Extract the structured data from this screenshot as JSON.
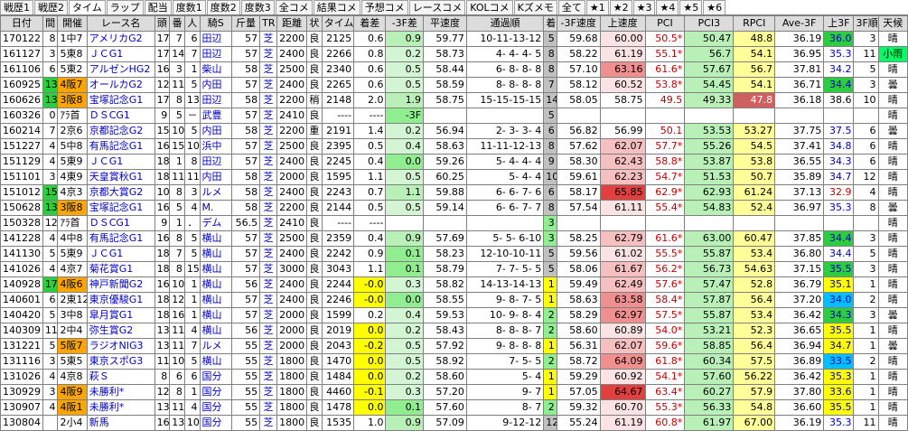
{
  "tabs": [
    "戦歴1",
    "戦歴2",
    "タイム",
    "ラップ",
    "配当",
    "度数1",
    "度数2",
    "度数3",
    "全コメ",
    "結果コメ",
    "予想コメ",
    "レースコメ",
    "KOLコメ",
    "Kズメモ",
    "全て",
    "★1",
    "★2",
    "★3",
    "★4",
    "★5",
    "★6"
  ],
  "active_tab": 2,
  "columns": [
    "日付",
    "間",
    "開催",
    "レース名",
    "頭",
    "番",
    "人",
    "騎S",
    "斤量",
    "TR",
    "距離",
    "状",
    "タイム",
    "着差",
    "-3F差",
    "平速度",
    "通過順",
    "着",
    "-3F速度",
    "上速度",
    "PCI",
    "PCI3",
    "RPCI",
    "Ave-3F",
    "上3F",
    "3F順",
    "天候"
  ],
  "rows": [
    {
      "d": "170122",
      "k": "8",
      "kai": "1中7",
      "race": "アメリカG2",
      "h": "17",
      "b": "7",
      "n": "6",
      "j": "田辺",
      "w": "57",
      "tr": "芝",
      "dist": "2200",
      "st": "良",
      "time": "2125",
      "diff": "0.6",
      "f3": "0.9",
      "hs": "59.77",
      "pass": "10-11-13-12",
      "ch": "5",
      "f3s": "59.68",
      "us": "60.00",
      "pci": "50.5*",
      "pci3": "50.47",
      "rpci": "48.8",
      "ave": "36.19",
      "up": "36.0",
      "up_rank": "3",
      "wx": "晴"
    },
    {
      "d": "161127",
      "k": "3",
      "kai": "5東8",
      "race": "ＪＣG1",
      "h": "17",
      "b": "14",
      "n": "7",
      "j": "田辺",
      "w": "57",
      "tr": "芝",
      "dist": "2400",
      "st": "良",
      "time": "2266",
      "diff": "0.8",
      "f3": "0.2",
      "hs": "58.73",
      "pass": "4- 4- 4- 5",
      "ch": "8",
      "f3s": "58.22",
      "us": "61.19",
      "pci": "55.1*",
      "pci3": "56.7",
      "rpci": "54.1",
      "ave": "36.95",
      "up": "35.3",
      "up_rank": "11",
      "wx": "小雨"
    },
    {
      "d": "161106",
      "k": "6",
      "kai": "5東2",
      "race": "アルゼンHG2",
      "h": "16",
      "b": "3",
      "n": "1",
      "j": "柴山",
      "w": "58",
      "tr": "芝",
      "dist": "2500",
      "st": "良",
      "time": "2340",
      "diff": "0.6",
      "f3": "0.5",
      "hs": "58.44",
      "pass": "6- 8- 8- 8",
      "ch": "8",
      "f3s": "57.10",
      "us": "63.16",
      "pci": "61.6*",
      "pci3": "57.67",
      "rpci": "56.7",
      "ave": "37.81",
      "up": "34.2",
      "up_rank": "5",
      "wx": "晴"
    },
    {
      "d": "160925",
      "k": "13",
      "kai": "4阪7",
      "race": "オールカG2",
      "h": "12",
      "b": "11",
      "n": "5",
      "j": "内田",
      "w": "57",
      "tr": "芝",
      "dist": "2400",
      "st": "良",
      "time": "2265",
      "diff": "0.6",
      "f3": "0.5",
      "hs": "58.59",
      "pass": "8- 8- 8- 8",
      "ch": "7",
      "f3s": "58.12",
      "us": "60.52",
      "pci": "53.8*",
      "pci3": "54.45",
      "rpci": "54.1",
      "ave": "36.71",
      "up": "34.4",
      "up_rank": "3",
      "wx": "曇"
    },
    {
      "d": "160626",
      "k": "13",
      "kai": "3阪8",
      "race": "宝塚記念G1",
      "h": "17",
      "b": "8",
      "n": "13",
      "j": "田辺",
      "w": "58",
      "tr": "芝",
      "dist": "2200",
      "st": "稍",
      "time": "2148",
      "diff": "2.0",
      "f3": "1.9",
      "hs": "58.75",
      "pass": "15-15-15-15",
      "ch": "14",
      "f3s": "58.05",
      "us": "58.75",
      "pci": "49.5",
      "pci3": "49.33",
      "rpci": "47.8",
      "ave": "36.18",
      "up": "38.6",
      "up_rank": "10",
      "wx": "晴"
    },
    {
      "d": "160326",
      "k": "0",
      "kai": "ｱﾗ首",
      "race": "ＤＳCG1",
      "h": "9",
      "b": "5",
      "n": "－",
      "j": "武豊",
      "w": "57",
      "tr": "芝",
      "dist": "2410",
      "st": "良",
      "time": "----",
      "diff": "----",
      "f3": "-3F",
      "hs": "",
      "pass": "",
      "ch": "5",
      "f3s": "",
      "us": "",
      "pci": "",
      "pci3": "",
      "rpci": "",
      "ave": "",
      "up": "",
      "up_rank": "",
      "wx": "晴"
    },
    {
      "d": "160214",
      "k": "7",
      "kai": "2京6",
      "race": "京都記念G2",
      "h": "15",
      "b": "10",
      "n": "5",
      "j": "内田",
      "w": "58",
      "tr": "芝",
      "dist": "2200",
      "st": "重",
      "time": "2191",
      "diff": "1.4",
      "f3": "0.2",
      "hs": "56.94",
      "pass": "2- 3- 3- 4",
      "ch": "6",
      "f3s": "56.82",
      "us": "56.99",
      "pci": "50.1",
      "pci3": "53.53",
      "rpci": "53.27",
      "ave": "37.75",
      "up": "37.5",
      "up_rank": "6",
      "wx": "曇"
    },
    {
      "d": "151227",
      "k": "4",
      "kai": "5中8",
      "race": "有馬記念G1",
      "h": "16",
      "b": "15",
      "n": "10",
      "j": "浜中",
      "w": "57",
      "tr": "芝",
      "dist": "2500",
      "st": "良",
      "time": "2395",
      "diff": "0.5",
      "f3": "0.4",
      "hs": "58.63",
      "pass": "11-11-12-13",
      "ch": "8",
      "f3s": "57.62",
      "us": "62.07",
      "pci": "57.7*",
      "pci3": "55.26",
      "rpci": "54.5",
      "ave": "37.41",
      "up": "34.8",
      "up_rank": "6",
      "wx": "晴"
    },
    {
      "d": "151129",
      "k": "4",
      "kai": "5東9",
      "race": "ＪＣG1",
      "h": "18",
      "b": "1",
      "n": "8",
      "j": "田辺",
      "w": "57",
      "tr": "芝",
      "dist": "2400",
      "st": "良",
      "time": "2245",
      "diff": "0.4",
      "f3": "0.0",
      "hs": "59.26",
      "pass": "5- 4- 4- 4",
      "ch": "9",
      "f3s": "58.30",
      "us": "62.43",
      "pci": "58.8*",
      "pci3": "53.87",
      "rpci": "53.8",
      "ave": "36.55",
      "up": "34.3",
      "up_rank": "6",
      "wx": "晴"
    },
    {
      "d": "151101",
      "k": "3",
      "kai": "4東9",
      "race": "天皇賞秋G1",
      "h": "18",
      "b": "11",
      "n": "11",
      "j": "内田",
      "w": "58",
      "tr": "芝",
      "dist": "2000",
      "st": "良",
      "time": "1595",
      "diff": "1.1",
      "f3": "0.5",
      "hs": "60.25",
      "pass": "5- 4- 4",
      "ch": "10",
      "f3s": "59.61",
      "us": "62.23",
      "pci": "54.7*",
      "pci3": "51.53",
      "rpci": "50.7",
      "ave": "35.89",
      "up": "34.7",
      "up_rank": "12",
      "wx": "晴"
    },
    {
      "d": "151012",
      "k": "15",
      "kai": "4京3",
      "race": "京都大賞G2",
      "h": "10",
      "b": "8",
      "n": "3",
      "j": "ルメ",
      "w": "58",
      "tr": "芝",
      "dist": "2400",
      "st": "良",
      "time": "2243",
      "diff": "0.7",
      "f3": "1.1",
      "hs": "59.88",
      "pass": "6- 6- 7- 6",
      "ch": "6",
      "f3s": "58.17",
      "us": "65.85",
      "pci": "62.9*",
      "pci3": "62.93",
      "rpci": "61.24",
      "ave": "37.13",
      "up": "32.9",
      "up_rank": "4",
      "wx": "晴"
    },
    {
      "d": "150628",
      "k": "13",
      "kai": "3阪8",
      "race": "宝塚記念G1",
      "h": "16",
      "b": "5",
      "n": "4",
      "j": "M.",
      "w": "58",
      "tr": "芝",
      "dist": "2200",
      "st": "良",
      "time": "2144",
      "diff": "0.5",
      "f3": "0.5",
      "hs": "59.14",
      "pass": "6- 6- 7- 7",
      "ch": "8",
      "f3s": "57.54",
      "us": "61.11",
      "pci": "55.4*",
      "pci3": "54.83",
      "rpci": "52.4",
      "ave": "36.97",
      "up": "35.3",
      "up_rank": "8",
      "wx": "曇"
    },
    {
      "d": "150328",
      "k": "12",
      "kai": "ｱﾗ首",
      "race": "ＤＳCG1",
      "h": "9",
      "b": "1",
      "n": "．",
      "j": "デム",
      "w": "56.5",
      "tr": "芝",
      "dist": "2410",
      "st": "良",
      "time": "----",
      "diff": "----",
      "f3": "",
      "hs": "",
      "pass": "",
      "ch": "3",
      "f3s": "",
      "us": "",
      "pci": "",
      "pci3": "",
      "rpci": "",
      "ave": "",
      "up": "",
      "up_rank": "",
      "wx": "晴"
    },
    {
      "d": "141228",
      "k": "4",
      "kai": "4中8",
      "race": "有馬記念G1",
      "h": "16",
      "b": "8",
      "n": "5",
      "j": "横山",
      "w": "57",
      "tr": "芝",
      "dist": "2500",
      "st": "良",
      "time": "2359",
      "diff": "0.4",
      "f3": "0.9",
      "hs": "57.69",
      "pass": "5- 5- 6-10",
      "ch": "3",
      "f3s": "58.25",
      "us": "62.79",
      "pci": "61.6*",
      "pci3": "63.00",
      "rpci": "60.47",
      "ave": "37.85",
      "up": "34.4",
      "up_rank": "3",
      "wx": "晴"
    },
    {
      "d": "141130",
      "k": "5",
      "kai": "5東9",
      "race": "ＪＣG1",
      "h": "18",
      "b": "7",
      "n": "5",
      "j": "横山",
      "w": "57",
      "tr": "芝",
      "dist": "2400",
      "st": "良",
      "time": "2242",
      "diff": "0.9",
      "f3": "0.1",
      "hs": "58.23",
      "pass": "12-10-10-11",
      "ch": "5",
      "f3s": "59.56",
      "us": "61.02",
      "pci": "55.5*",
      "pci3": "55.87",
      "rpci": "53.4",
      "ave": "36.80",
      "up": "34.4",
      "up_rank": "5",
      "wx": "晴"
    },
    {
      "d": "141026",
      "k": "4",
      "kai": "4京7",
      "race": "菊花賞G1",
      "h": "18",
      "b": "8",
      "n": "15",
      "j": "横山",
      "w": "57",
      "tr": "芝",
      "dist": "3000",
      "st": "良",
      "time": "3043",
      "diff": "1.1",
      "f3": "0.1",
      "hs": "58.79",
      "pass": "7- 7- 5- 5",
      "ch": "5",
      "f3s": "58.06",
      "us": "61.67",
      "pci": "56.2*",
      "pci3": "56.73",
      "rpci": "54.63",
      "ave": "37.15",
      "up": "35.5",
      "up_rank": "3",
      "wx": "晴"
    },
    {
      "d": "140928",
      "k": "17",
      "kai": "4阪6",
      "race": "神戸新聞G2",
      "h": "16",
      "b": "10",
      "n": "1",
      "j": "横山",
      "w": "56",
      "tr": "芝",
      "dist": "2400",
      "st": "良",
      "time": "2244",
      "diff": "-0.0",
      "f3": "0.3",
      "hs": "58.82",
      "pass": "14-13-14-13",
      "ch": "1",
      "f3s": "59.49",
      "us": "62.49",
      "pci": "57.6*",
      "pci3": "57.47",
      "rpci": "52.8",
      "ave": "36.79",
      "up": "35.1",
      "up_rank": "1",
      "wx": "晴"
    },
    {
      "d": "140601",
      "k": "6",
      "kai": "2東12",
      "race": "東京優駿G1",
      "h": "18",
      "b": "12",
      "n": "1",
      "j": "横山",
      "w": "57",
      "tr": "芝",
      "dist": "2400",
      "st": "良",
      "time": "2246",
      "diff": "-0.0",
      "f3": "0.0",
      "hs": "58.55",
      "pass": "9- 8- 7- 5",
      "ch": "1",
      "f3s": "58.63",
      "us": "63.58",
      "pci": "58.4*",
      "pci3": "57.87",
      "rpci": "56.4",
      "ave": "37.20",
      "up": "34.0",
      "up_rank": "2",
      "wx": "晴"
    },
    {
      "d": "140420",
      "k": "5",
      "kai": "3中8",
      "race": "皐月賞G1",
      "h": "18",
      "b": "16",
      "n": "1",
      "j": "横山",
      "w": "57",
      "tr": "芝",
      "dist": "2000",
      "st": "良",
      "time": "1599",
      "diff": "0.2",
      "f3": "0.4",
      "hs": "59.53",
      "pass": "10- 9- 8- 4",
      "ch": "2",
      "f3s": "58.29",
      "us": "62.97",
      "pci": "57.5*",
      "pci3": "55.87",
      "rpci": "53.4",
      "ave": "36.42",
      "up": "34.3",
      "up_rank": "3",
      "wx": "曇"
    },
    {
      "d": "140309",
      "k": "11",
      "kai": "2中4",
      "race": "弥生賞G2",
      "h": "13",
      "b": "11",
      "n": "4",
      "j": "横山",
      "w": "56",
      "tr": "芝",
      "dist": "2000",
      "st": "良",
      "time": "2019",
      "diff": "0.0",
      "f3": "0.2",
      "hs": "58.43",
      "pass": "8- 8- 8- 7",
      "ch": "2",
      "f3s": "58.60",
      "us": "60.89",
      "pci": "54.0*",
      "pci3": "53.21",
      "rpci": "52.3",
      "ave": "36.65",
      "up": "35.5",
      "up_rank": "1",
      "wx": "晴"
    },
    {
      "d": "131221",
      "k": "5",
      "kai": "5阪7",
      "race": "ラジオNIG3",
      "h": "13",
      "b": "11",
      "n": "7",
      "j": "ルメ",
      "w": "55",
      "tr": "芝",
      "dist": "2000",
      "st": "良",
      "time": "2043",
      "diff": "-0.2",
      "f3": "0.5",
      "hs": "57.92",
      "pass": "9- 8- 8- 8",
      "ch": "1",
      "f3s": "56.31",
      "us": "62.07",
      "pci": "59.6*",
      "pci3": "58.85",
      "rpci": "56.4",
      "ave": "36.94",
      "up": "34.7",
      "up_rank": "1",
      "wx": "曇"
    },
    {
      "d": "131116",
      "k": "3",
      "kai": "5東5",
      "race": "東京スポG3",
      "h": "11",
      "b": "10",
      "n": "5",
      "j": "横山",
      "w": "55",
      "tr": "芝",
      "dist": "1800",
      "st": "良",
      "time": "1470",
      "diff": "0.0",
      "f3": "0.5",
      "hs": "58.92",
      "pass": "7- 5- 5",
      "ch": "2",
      "f3s": "58.72",
      "us": "64.09",
      "pci": "61.8*",
      "pci3": "60.34",
      "rpci": "57.5",
      "ave": "36.89",
      "up": "33.5",
      "up_rank": "2",
      "wx": "晴"
    },
    {
      "d": "131026",
      "k": "4",
      "kai": "4京8",
      "race": "萩Ｓ",
      "h": "8",
      "b": "6",
      "n": "6",
      "j": "国分",
      "w": "55",
      "tr": "芝",
      "dist": "1800",
      "st": "良",
      "time": "1484",
      "diff": "0.0",
      "f3": "0.2",
      "hs": "58.60",
      "pass": "5- 4",
      "ch": "1",
      "f3s": "59.29",
      "us": "60.92",
      "pci": "54.1*",
      "pci3": "57.60",
      "rpci": "56.22",
      "ave": "36.42",
      "up": "35.3",
      "up_rank": "1",
      "wx": "晴"
    },
    {
      "d": "130929",
      "k": "3",
      "kai": "4阪9",
      "race": "未勝利*",
      "h": "12",
      "b": "8",
      "n": "1",
      "j": "国分",
      "w": "55",
      "tr": "芝",
      "dist": "1800",
      "st": "良",
      "time": "4460",
      "diff": "-0.1",
      "f3": "0.3",
      "hs": "57.20",
      "pass": "9- 7",
      "ch": "1",
      "f3s": "57.05",
      "us": "64.67",
      "pci": "63.4*",
      "pci3": "60.27",
      "rpci": "57.9",
      "ave": "37.80",
      "up": "33.6",
      "up_rank": "1",
      "wx": "晴"
    },
    {
      "d": "130907",
      "k": "4",
      "kai": "4阪1",
      "race": "未勝利*",
      "h": "13",
      "b": "11",
      "n": "4",
      "j": "国分",
      "w": "55",
      "tr": "芝",
      "dist": "1800",
      "st": "良",
      "time": "1478",
      "diff": "0.0",
      "f3": "0.1",
      "hs": "57.60",
      "pass": "8- 7",
      "ch": "2",
      "f3s": "59.32",
      "us": "60.70",
      "pci": "55.3*",
      "pci3": "56.33",
      "rpci": "54.8",
      "ave": "36.60",
      "up": "35.5",
      "up_rank": "1",
      "wx": "晴"
    },
    {
      "d": "130804",
      "k": "",
      "kai": "2小4",
      "race": "新馬",
      "h": "16",
      "b": "13",
      "n": "10",
      "j": "国分",
      "w": "55",
      "tr": "芝",
      "dist": "1800",
      "st": "良",
      "time": "1535",
      "diff": "1.0",
      "f3": "0.9",
      "hs": "57.09",
      "pass": "9-12-12",
      "ch": "12",
      "f3s": "55.24",
      "us": "61.19",
      "pci": "60.8*",
      "pci3": "61.97",
      "rpci": "67.00",
      "ave": "36.19",
      "up": "35.3",
      "up_rank": "11",
      "wx": "晴"
    }
  ]
}
